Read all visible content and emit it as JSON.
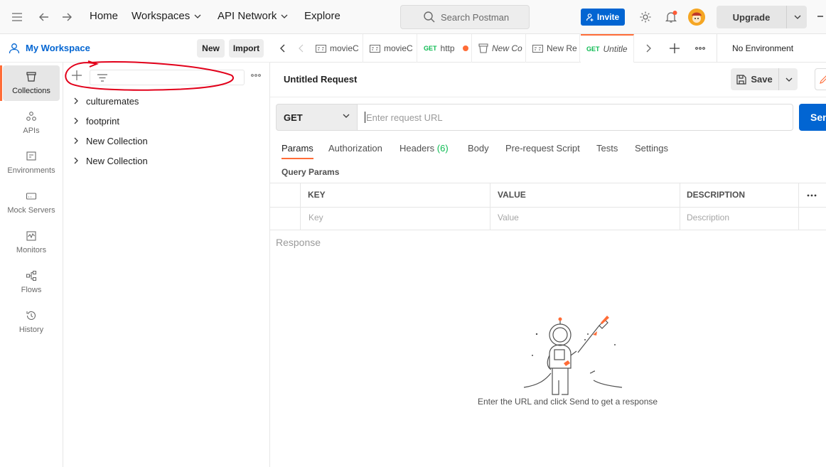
{
  "topbar": {
    "nav": [
      "Home",
      "Workspaces",
      "API Network",
      "Explore"
    ],
    "search_placeholder": "Search Postman",
    "invite_label": "Invite",
    "upgrade_label": "Upgrade"
  },
  "workspace": {
    "name": "My Workspace",
    "new_label": "New",
    "import_label": "Import"
  },
  "leftnav": [
    {
      "label": "Collections",
      "icon": "collections-icon"
    },
    {
      "label": "APIs",
      "icon": "apis-icon"
    },
    {
      "label": "Environments",
      "icon": "environments-icon"
    },
    {
      "label": "Mock Servers",
      "icon": "mock-servers-icon"
    },
    {
      "label": "Monitors",
      "icon": "monitors-icon"
    },
    {
      "label": "Flows",
      "icon": "flows-icon"
    },
    {
      "label": "History",
      "icon": "history-icon"
    }
  ],
  "collections": [
    "culturemates",
    "footprint",
    "New Collection",
    "New Collection"
  ],
  "tabs": [
    {
      "label": "movieC",
      "icon": "collection-icon"
    },
    {
      "label": "movieC",
      "icon": "collection-icon"
    },
    {
      "method": "GET",
      "label": "http",
      "unsaved": true
    },
    {
      "label": "New Co",
      "icon": "folder-icon"
    },
    {
      "label": "New Re",
      "icon": "collection-icon"
    },
    {
      "method": "GET",
      "label": "Untitle",
      "active": true
    }
  ],
  "environment": "No Environment",
  "request": {
    "title": "Untitled Request",
    "save_label": "Save",
    "method": "GET",
    "url_placeholder": "Enter request URL",
    "send_label": "Sen"
  },
  "subtabs": [
    {
      "label": "Params",
      "active": true
    },
    {
      "label": "Authorization"
    },
    {
      "label": "Headers",
      "count": "(6)"
    },
    {
      "label": "Body"
    },
    {
      "label": "Pre-request Script"
    },
    {
      "label": "Tests"
    },
    {
      "label": "Settings"
    }
  ],
  "query_params": {
    "title": "Query Params",
    "columns": [
      "KEY",
      "VALUE",
      "DESCRIPTION"
    ],
    "placeholders": [
      "Key",
      "Value",
      "Description"
    ]
  },
  "response": {
    "title": "Response",
    "hint": "Enter the URL and click Send to get a response"
  },
  "colors": {
    "accent_orange": "#ff6c37",
    "primary_blue": "#0265d2",
    "method_green": "#0cbb52",
    "annotation_red": "#e2001a"
  }
}
